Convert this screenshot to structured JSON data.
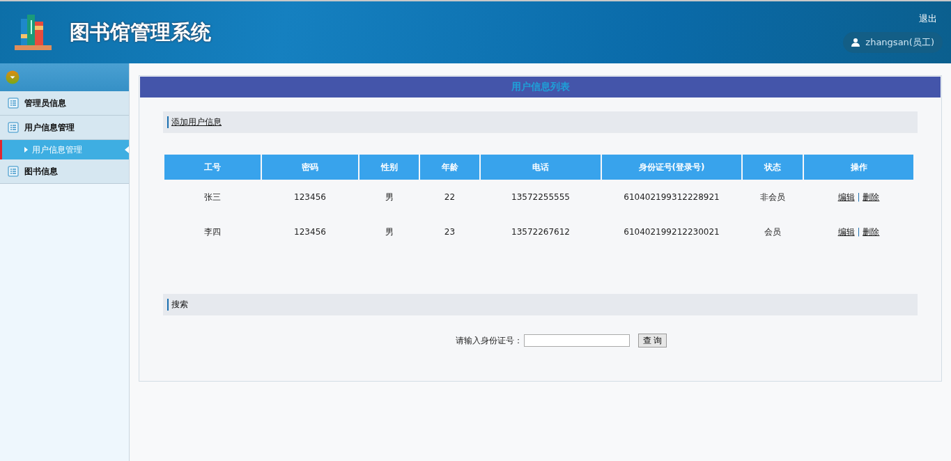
{
  "header": {
    "title": "图书馆管理系统",
    "logout": "退出",
    "user": "zhangsan(员工)"
  },
  "sidebar": {
    "items": [
      {
        "label": "管理员信息",
        "selected": false
      },
      {
        "label": "用户信息管理",
        "selected": false,
        "children": [
          {
            "label": "用户信息管理",
            "selected": true
          }
        ]
      },
      {
        "label": "图书信息",
        "selected": false
      }
    ]
  },
  "panel": {
    "title": "用户信息列表",
    "add_link": "添加用户信息",
    "table": {
      "columns": [
        "工号",
        "密码",
        "性别",
        "年龄",
        "电话",
        "身份证号(登录号)",
        "状态",
        "操作"
      ],
      "rows": [
        {
          "cells": [
            "张三",
            "123456",
            "男",
            "22",
            "13572255555",
            "610402199312228921",
            "非会员"
          ],
          "actions": [
            "编辑",
            "删除"
          ],
          "separator": "|"
        },
        {
          "cells": [
            "李四",
            "123456",
            "男",
            "23",
            "13572267612",
            "610402199212230021",
            "会员"
          ],
          "actions": [
            "编辑",
            "删除"
          ],
          "separator": "|"
        }
      ]
    },
    "search": {
      "title": "搜索",
      "label": "请输入身份证号：",
      "button": "查 询"
    }
  }
}
